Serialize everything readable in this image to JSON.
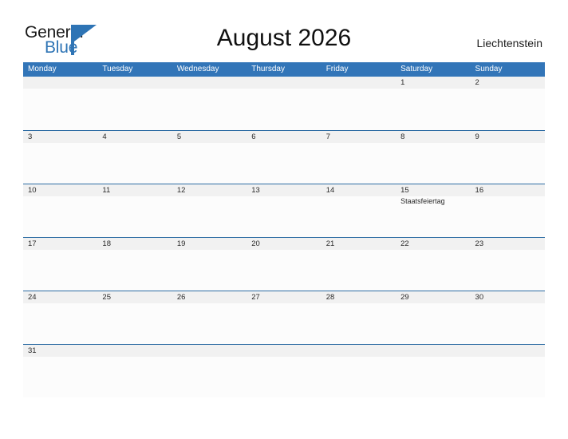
{
  "brand": {
    "name_part1": "General",
    "name_part2": "Blue",
    "color_dark": "#1b1b1b",
    "color_blue": "#2e74b5"
  },
  "header": {
    "title": "August 2026",
    "country": "Liechtenstein"
  },
  "colors": {
    "header_blue": "#3275b8",
    "row_border_blue": "#2e6da4",
    "day_band_gray": "#f1f1f1",
    "cell_background": "#fcfcfc",
    "page_background": "#ffffff"
  },
  "calendar": {
    "month": "August",
    "year": "2026",
    "weekdays": [
      "Monday",
      "Tuesday",
      "Wednesday",
      "Thursday",
      "Friday",
      "Saturday",
      "Sunday"
    ],
    "weeks": [
      [
        {
          "day": "",
          "event": ""
        },
        {
          "day": "",
          "event": ""
        },
        {
          "day": "",
          "event": ""
        },
        {
          "day": "",
          "event": ""
        },
        {
          "day": "",
          "event": ""
        },
        {
          "day": "1",
          "event": ""
        },
        {
          "day": "2",
          "event": ""
        }
      ],
      [
        {
          "day": "3",
          "event": ""
        },
        {
          "day": "4",
          "event": ""
        },
        {
          "day": "5",
          "event": ""
        },
        {
          "day": "6",
          "event": ""
        },
        {
          "day": "7",
          "event": ""
        },
        {
          "day": "8",
          "event": ""
        },
        {
          "day": "9",
          "event": ""
        }
      ],
      [
        {
          "day": "10",
          "event": ""
        },
        {
          "day": "11",
          "event": ""
        },
        {
          "day": "12",
          "event": ""
        },
        {
          "day": "13",
          "event": ""
        },
        {
          "day": "14",
          "event": ""
        },
        {
          "day": "15",
          "event": "Staatsfeiertag"
        },
        {
          "day": "16",
          "event": ""
        }
      ],
      [
        {
          "day": "17",
          "event": ""
        },
        {
          "day": "18",
          "event": ""
        },
        {
          "day": "19",
          "event": ""
        },
        {
          "day": "20",
          "event": ""
        },
        {
          "day": "21",
          "event": ""
        },
        {
          "day": "22",
          "event": ""
        },
        {
          "day": "23",
          "event": ""
        }
      ],
      [
        {
          "day": "24",
          "event": ""
        },
        {
          "day": "25",
          "event": ""
        },
        {
          "day": "26",
          "event": ""
        },
        {
          "day": "27",
          "event": ""
        },
        {
          "day": "28",
          "event": ""
        },
        {
          "day": "29",
          "event": ""
        },
        {
          "day": "30",
          "event": ""
        }
      ],
      [
        {
          "day": "31",
          "event": ""
        },
        {
          "day": "",
          "event": ""
        },
        {
          "day": "",
          "event": ""
        },
        {
          "day": "",
          "event": ""
        },
        {
          "day": "",
          "event": ""
        },
        {
          "day": "",
          "event": ""
        },
        {
          "day": "",
          "event": ""
        }
      ]
    ]
  }
}
